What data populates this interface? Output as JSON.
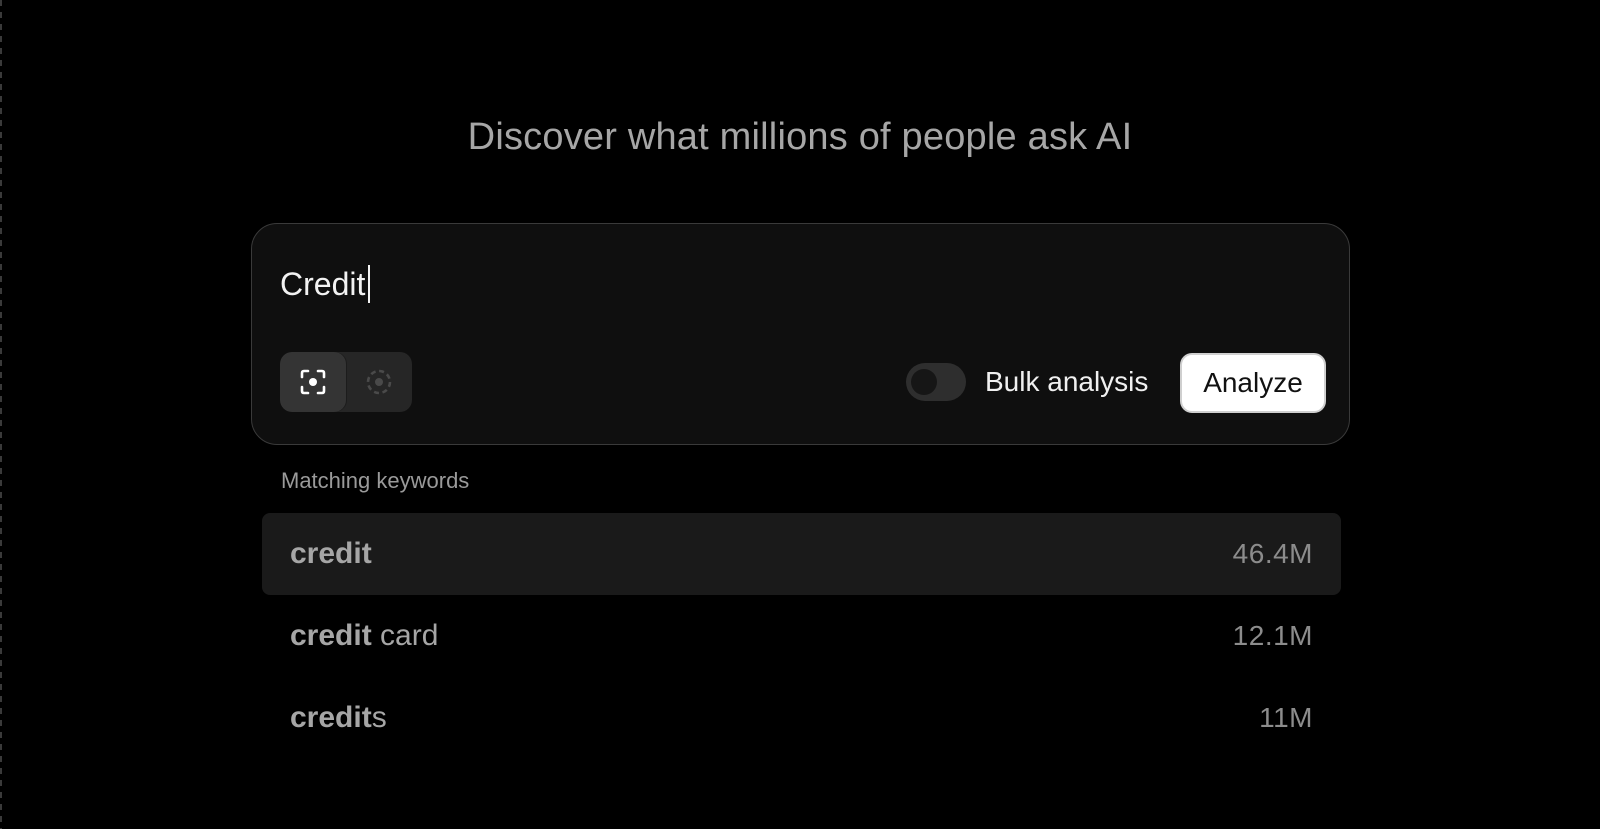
{
  "headline": "Discover what millions of people ask AI",
  "search": {
    "query": "Credit",
    "bulk_label": "Bulk analysis",
    "bulk_enabled": false,
    "analyze_label": "Analyze",
    "modes": [
      {
        "icon": "focus-target-icon",
        "active": true
      },
      {
        "icon": "dashed-circle-icon",
        "active": false
      }
    ]
  },
  "results": {
    "label": "Matching keywords",
    "items": [
      {
        "match": "credit",
        "rest": "",
        "count": "46.4M",
        "highlighted": true
      },
      {
        "match": "credit",
        "rest": " card",
        "count": "12.1M",
        "highlighted": false
      },
      {
        "match": "credit",
        "rest": "s",
        "count": "11M",
        "highlighted": false
      }
    ]
  },
  "colors": {
    "background": "#000000",
    "card": "#0f0f0f",
    "accent_button": "#ffffff"
  }
}
